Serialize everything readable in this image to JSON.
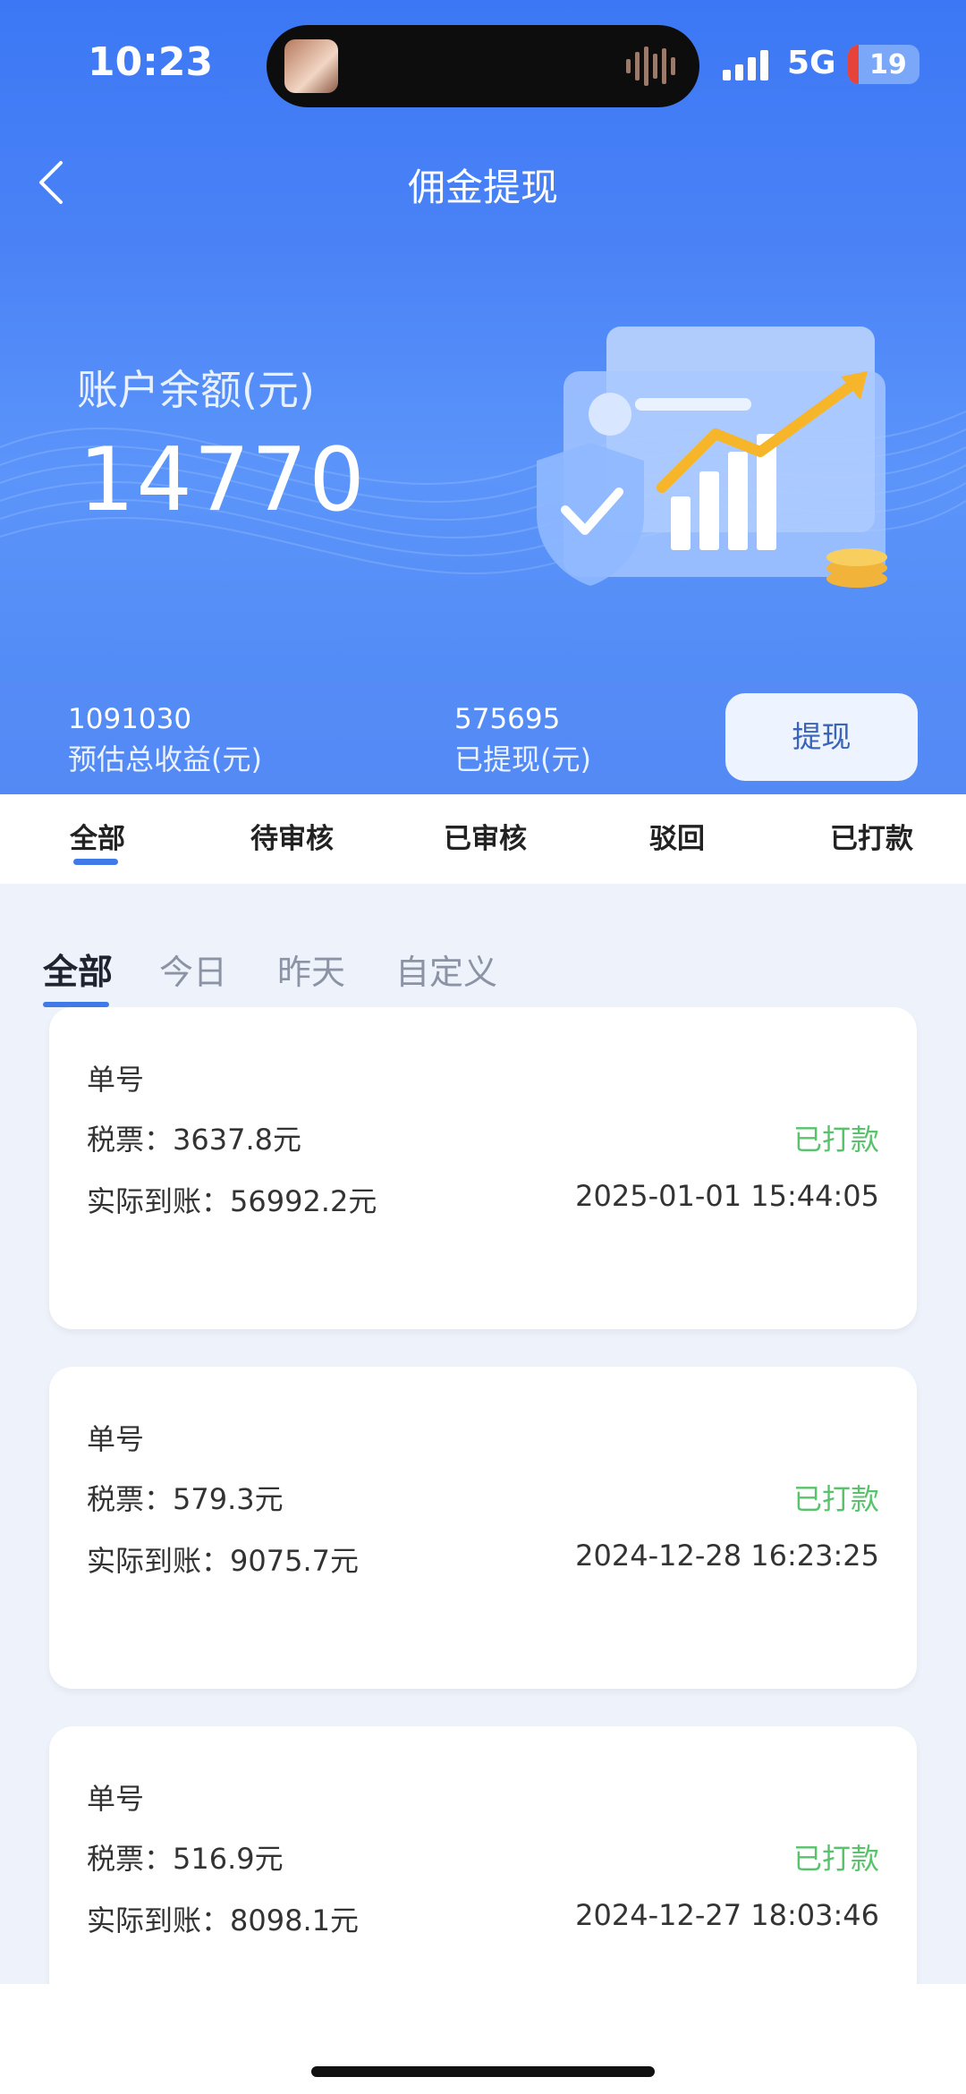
{
  "status_bar": {
    "time": "10:23",
    "network": "5G",
    "battery": "19"
  },
  "header": {
    "title": "佣金提现"
  },
  "balance": {
    "label": "账户余额(元)",
    "value": "14770"
  },
  "stats": {
    "estimated_total": {
      "value": "1091030",
      "label": "预估总收益(元)"
    },
    "withdrawn": {
      "value": "575695",
      "label": "已提现(元)"
    }
  },
  "withdraw_button": "提现",
  "status_tabs": [
    "全部",
    "待审核",
    "已审核",
    "驳回",
    "已打款"
  ],
  "date_filters": [
    "全部",
    "今日",
    "昨天",
    "自定义"
  ],
  "records": [
    {
      "order_label": "单号",
      "tax": "税票：3637.8元",
      "actual": "实际到账：56992.2元",
      "status": "已打款",
      "time": "2025-01-01 15:44:05"
    },
    {
      "order_label": "单号",
      "tax": "税票：579.3元",
      "actual": "实际到账：9075.7元",
      "status": "已打款",
      "time": "2024-12-28 16:23:25"
    },
    {
      "order_label": "单号",
      "tax": "税票：516.9元",
      "actual": "实际到账：8098.1元",
      "status": "已打款",
      "time": "2024-12-27 18:03:46"
    }
  ],
  "colors": {
    "primary": "#3f7ae8",
    "success": "#58c36b",
    "hero": "#4a82f6"
  }
}
